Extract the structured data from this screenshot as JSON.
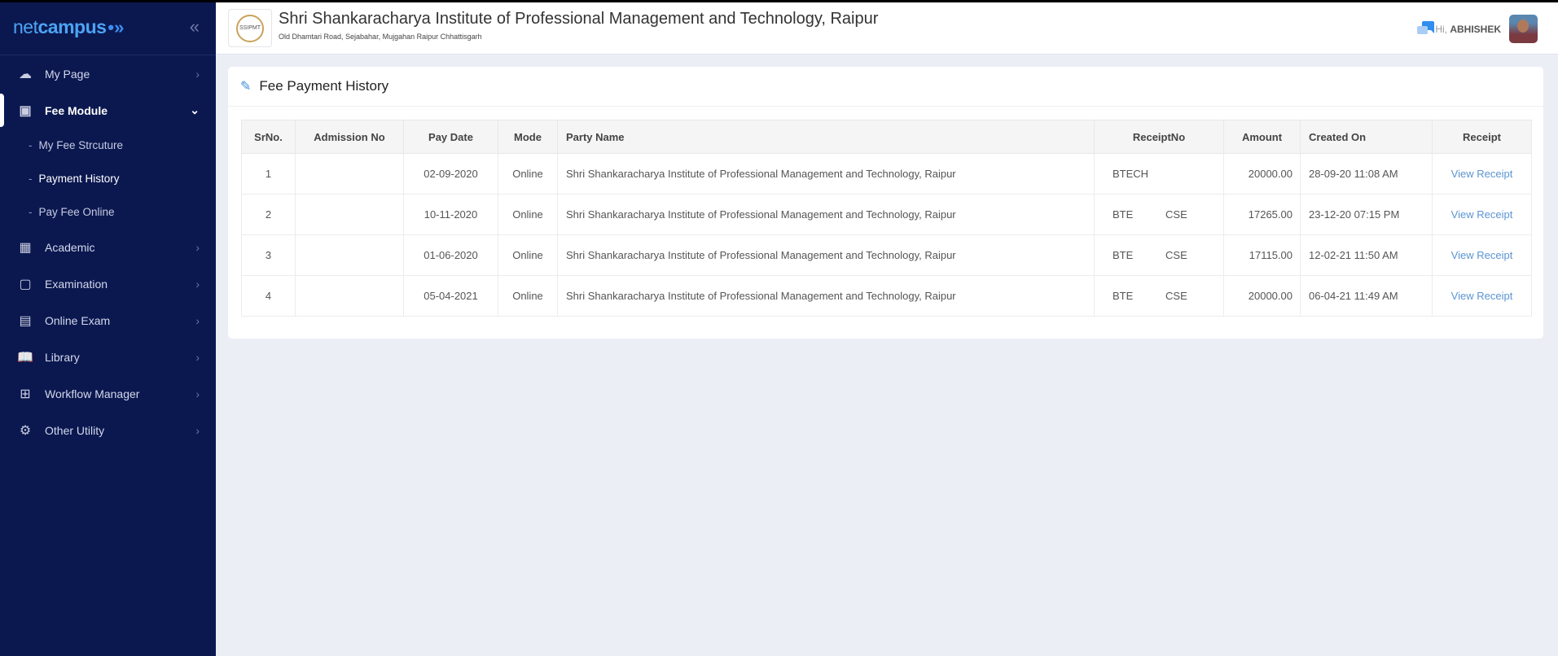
{
  "brand": {
    "part1": "net",
    "part2": "campus",
    "collapse_icon": "double-chevron-left"
  },
  "sidebar": {
    "items": [
      {
        "label": "My Page",
        "icon": "cloud-icon"
      },
      {
        "label": "Fee Module",
        "icon": "money-icon",
        "expanded": true
      },
      {
        "label": "Academic",
        "icon": "building-icon"
      },
      {
        "label": "Examination",
        "icon": "clipboard-icon"
      },
      {
        "label": "Online Exam",
        "icon": "monitor-icon"
      },
      {
        "label": "Library",
        "icon": "reader-icon"
      },
      {
        "label": "Workflow Manager",
        "icon": "workflow-icon"
      },
      {
        "label": "Other Utility",
        "icon": "utility-icon"
      }
    ],
    "fee_sub": [
      {
        "label": "My Fee Strcuture"
      },
      {
        "label": "Payment History",
        "active": true
      },
      {
        "label": "Pay Fee Online"
      }
    ]
  },
  "header": {
    "logo_text": "SSIPMT",
    "institute": "Shri Shankaracharya Institute of Professional Management and Technology, Raipur",
    "address": "Old Dhamtari Road, Sejabahar, Mujgahan Raipur Chhattisgarh",
    "greeting": "Hi,",
    "user": "ABHISHEK"
  },
  "card": {
    "title": "Fee Payment History"
  },
  "table": {
    "headers": [
      "SrNo.",
      "Admission No",
      "Pay Date",
      "Mode",
      "Party Name",
      "ReceiptNo",
      "Amount",
      "Created On",
      "Receipt"
    ],
    "rows": [
      {
        "sr": "1",
        "adm": "",
        "date": "02-09-2020",
        "mode": "Online",
        "party": "Shri Shankaracharya Institute of Professional Management and Technology, Raipur",
        "receipt": "BTECH",
        "amount": "20000.00",
        "created": "28-09-20 11:08 AM",
        "link": "View Receipt"
      },
      {
        "sr": "2",
        "adm": "",
        "date": "10-11-2020",
        "mode": "Online",
        "party": "Shri Shankaracharya Institute of Professional Management and Technology, Raipur",
        "receipt": "BTE           CSE",
        "amount": "17265.00",
        "created": "23-12-20 07:15 PM",
        "link": "View Receipt"
      },
      {
        "sr": "3",
        "adm": "",
        "date": "01-06-2020",
        "mode": "Online",
        "party": "Shri Shankaracharya Institute of Professional Management and Technology, Raipur",
        "receipt": "BTE           CSE",
        "amount": "17115.00",
        "created": "12-02-21 11:50 AM",
        "link": "View Receipt"
      },
      {
        "sr": "4",
        "adm": "",
        "date": "05-04-2021",
        "mode": "Online",
        "party": "Shri Shankaracharya Institute of Professional Management and Technology, Raipur",
        "receipt": "BTE           CSE",
        "amount": "20000.00",
        "created": "06-04-21 11:49 AM",
        "link": "View Receipt"
      }
    ]
  },
  "colors": {
    "sidebar": "#0b1850",
    "accent": "#4ca4f4",
    "link": "#5b95d2"
  }
}
